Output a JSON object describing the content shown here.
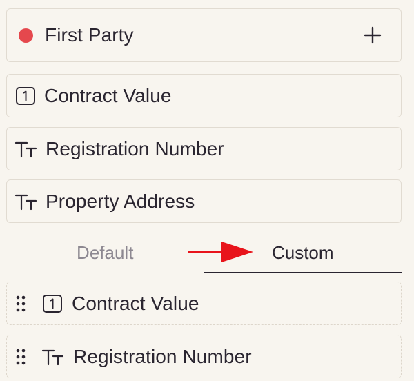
{
  "party": {
    "label": "First Party",
    "dot_color": "#e5484d",
    "add_icon": "plus-icon"
  },
  "fields": [
    {
      "label": "Contract Value",
      "icon": "number-icon"
    },
    {
      "label": "Registration Number",
      "icon": "text-type-icon"
    },
    {
      "label": "Property Address",
      "icon": "text-type-icon"
    }
  ],
  "tabs": {
    "default": "Default",
    "custom": "Custom",
    "active": "custom"
  },
  "annotation": {
    "arrow_color": "#e8141b"
  },
  "custom_fields": [
    {
      "label": "Contract Value",
      "icon": "number-icon"
    },
    {
      "label": "Registration Number",
      "icon": "text-type-icon"
    }
  ]
}
